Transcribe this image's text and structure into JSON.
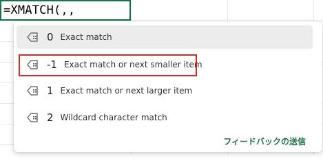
{
  "cell": {
    "formula": "=XMATCH(,,"
  },
  "dropdown": {
    "options": [
      {
        "value": "0",
        "description": "Exact match",
        "icon": "tag-list-icon"
      },
      {
        "value": "-1",
        "description": "Exact match or next smaller item",
        "icon": "tag-list-icon"
      },
      {
        "value": "1",
        "description": "Exact match or next larger item",
        "icon": "tag-list-icon"
      },
      {
        "value": "2",
        "description": "Wildcard character match",
        "icon": "tag-list-icon"
      }
    ],
    "feedback_label": "フィードバックの送信"
  },
  "colors": {
    "accent_green": "#1e7145",
    "selected_bg": "#ececec",
    "highlight_red": "#d42a2a"
  }
}
